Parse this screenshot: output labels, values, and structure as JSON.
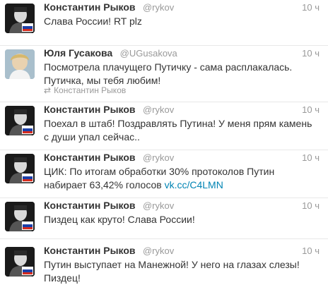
{
  "tweets": [
    {
      "name": "Константин Рыков",
      "handle": "@rykov",
      "time": "10 ч",
      "text": "Слава России! RT plz",
      "avatar": "kryukov-avatar"
    },
    {
      "name": "Юля Гусакова",
      "handle": "@UGusakova",
      "time": "10 ч",
      "text": "Посмотрела плачущего Путичку - сама расплакалась. Путичка, мы тебя любим!",
      "retweeted_by": "Константин Рыков",
      "avatar": "gusakova-avatar"
    },
    {
      "name": "Константин Рыков",
      "handle": "@rykov",
      "time": "10 ч",
      "text": "Поехал в штаб! Поздравлять Путина! У меня прям камень с души упал сейчас..",
      "avatar": "kryukov-avatar"
    },
    {
      "name": "Константин Рыков",
      "handle": "@rykov",
      "time": "10 ч",
      "text": "ЦИК: По итогам обработки 30% протоколов Путин набирает 63,42% голосов",
      "link": "vk.cc/C4LMN",
      "avatar": "kryukov-avatar"
    },
    {
      "name": "Константин Рыков",
      "handle": "@rykov",
      "time": "10 ч",
      "text": "Пиздец как круто! Слава России!",
      "avatar": "kryukov-avatar"
    },
    {
      "name": "Константин Рыков",
      "handle": "@rykov",
      "time": "10 ч",
      "text": "Путин выступает на Манежной! У него на глазах слезы! Пиздец!",
      "avatar": "kryukov-avatar"
    }
  ],
  "colors": {
    "name": "#333333",
    "meta": "#999999",
    "link": "#0084b4",
    "flag_white": "#ffffff",
    "flag_blue": "#1c3fa8",
    "flag_red": "#d52b1e"
  }
}
